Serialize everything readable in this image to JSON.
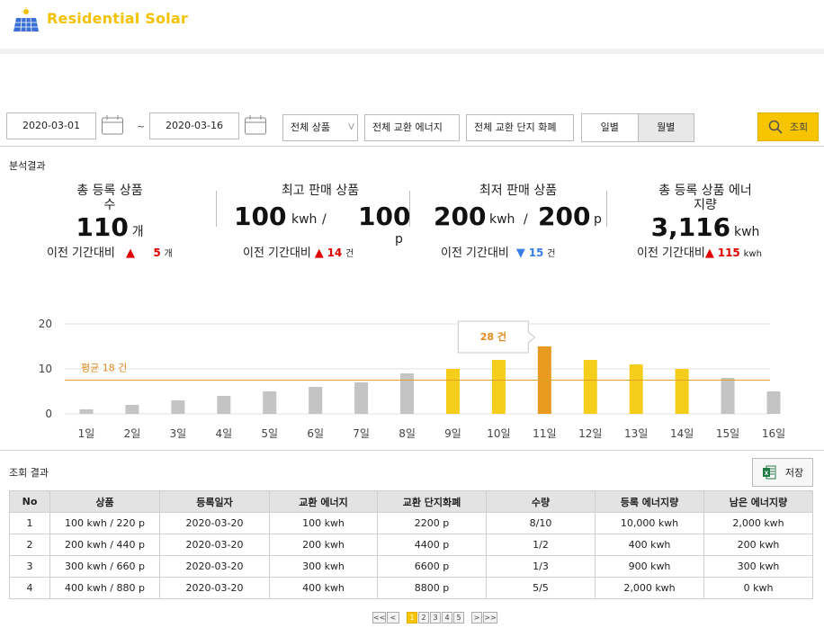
{
  "app": {
    "title": "Residential Solar",
    "logo_icon": "solar-panel-icon"
  },
  "filters": {
    "start_date": "2020-03-01",
    "end_date": "2020-03-16",
    "range_sep": "~",
    "product_select": "전체 상품",
    "energy_select": "전체 교환 에너지",
    "currency_select": "전체 교환 단지 화폐",
    "period_options": [
      "일별",
      "월별"
    ],
    "period_selected": "월별",
    "search_label": "조회"
  },
  "analysis": {
    "section_title": "분석결과",
    "cmp_label": "이전 기간대비",
    "stats": [
      {
        "label1": "총 등록 상품",
        "label2": "수",
        "value": "110",
        "unit": "개",
        "delta": "5",
        "delta_unit": "개",
        "direction": "up"
      },
      {
        "label1": "최고 판매 상품",
        "value_a": "100",
        "unit_a": "kwh",
        "slash": "/",
        "value_b": "100",
        "unit_b": "p",
        "delta": "14",
        "delta_unit": "건",
        "direction": "up"
      },
      {
        "label1": "최저 판매 상품",
        "value_a": "200",
        "unit_a": "kwh",
        "slash": "/",
        "value_b": "200",
        "unit_b": "p",
        "delta": "15",
        "delta_unit": "건",
        "direction": "down"
      },
      {
        "label1": "총 등록 상품 에너",
        "label2": "지량",
        "value": "3,116",
        "unit": "kwh",
        "delta": "115",
        "delta_unit": "kwh",
        "direction": "up"
      }
    ]
  },
  "chart_data": {
    "type": "bar",
    "categories": [
      "1일",
      "2일",
      "3일",
      "4일",
      "5일",
      "6일",
      "7일",
      "8일",
      "9일",
      "10일",
      "11일",
      "12일",
      "13일",
      "14일",
      "15일",
      "16일"
    ],
    "values": [
      1,
      2,
      3,
      4,
      5,
      6,
      7,
      9,
      10,
      12,
      15,
      12,
      11,
      10,
      8,
      5
    ],
    "colors": [
      "#c4c4c4",
      "#c4c4c4",
      "#c4c4c4",
      "#c4c4c4",
      "#c4c4c4",
      "#c4c4c4",
      "#c4c4c4",
      "#c4c4c4",
      "#f5cd1b",
      "#f5cd1b",
      "#e89a21",
      "#f5cd1b",
      "#f5cd1b",
      "#f5cd1b",
      "#c4c4c4",
      "#c4c4c4"
    ],
    "yticks": [
      0,
      10,
      20
    ],
    "ylim": [
      0,
      20
    ],
    "average_value": 7.5,
    "average_label": "평균 18 건",
    "tooltip_label": "28 건",
    "tooltip_index": 10,
    "grid": true
  },
  "results": {
    "section_title": "조회 결과",
    "save_label": "저장",
    "save_icon": "excel-icon",
    "columns": [
      "No",
      "상품",
      "등록일자",
      "교환 에너지",
      "교환 단지화폐",
      "수량",
      "등록 에너지량",
      "남은 에너지량"
    ],
    "rows": [
      [
        "1",
        "100 kwh / 220 p",
        "2020-03-20",
        "100 kwh",
        "2200 p",
        "8/10",
        "10,000 kwh",
        "2,000 kwh"
      ],
      [
        "2",
        "200 kwh / 440 p",
        "2020-03-20",
        "200 kwh",
        "4400 p",
        "1/2",
        "400 kwh",
        "200 kwh"
      ],
      [
        "3",
        "300 kwh / 660 p",
        "2020-03-20",
        "300 kwh",
        "6600 p",
        "1/3",
        "900 kwh",
        "300 kwh"
      ],
      [
        "4",
        "400 kwh / 880 p",
        "2020-03-20",
        "400 kwh",
        "8800 p",
        "5/5",
        "2,000 kwh",
        "0 kwh"
      ]
    ]
  },
  "pagination": {
    "first": "<<",
    "prev": "<",
    "pages": [
      "1",
      "2",
      "3",
      "4",
      "5"
    ],
    "current": "1",
    "next": ">",
    "last": ">>"
  }
}
